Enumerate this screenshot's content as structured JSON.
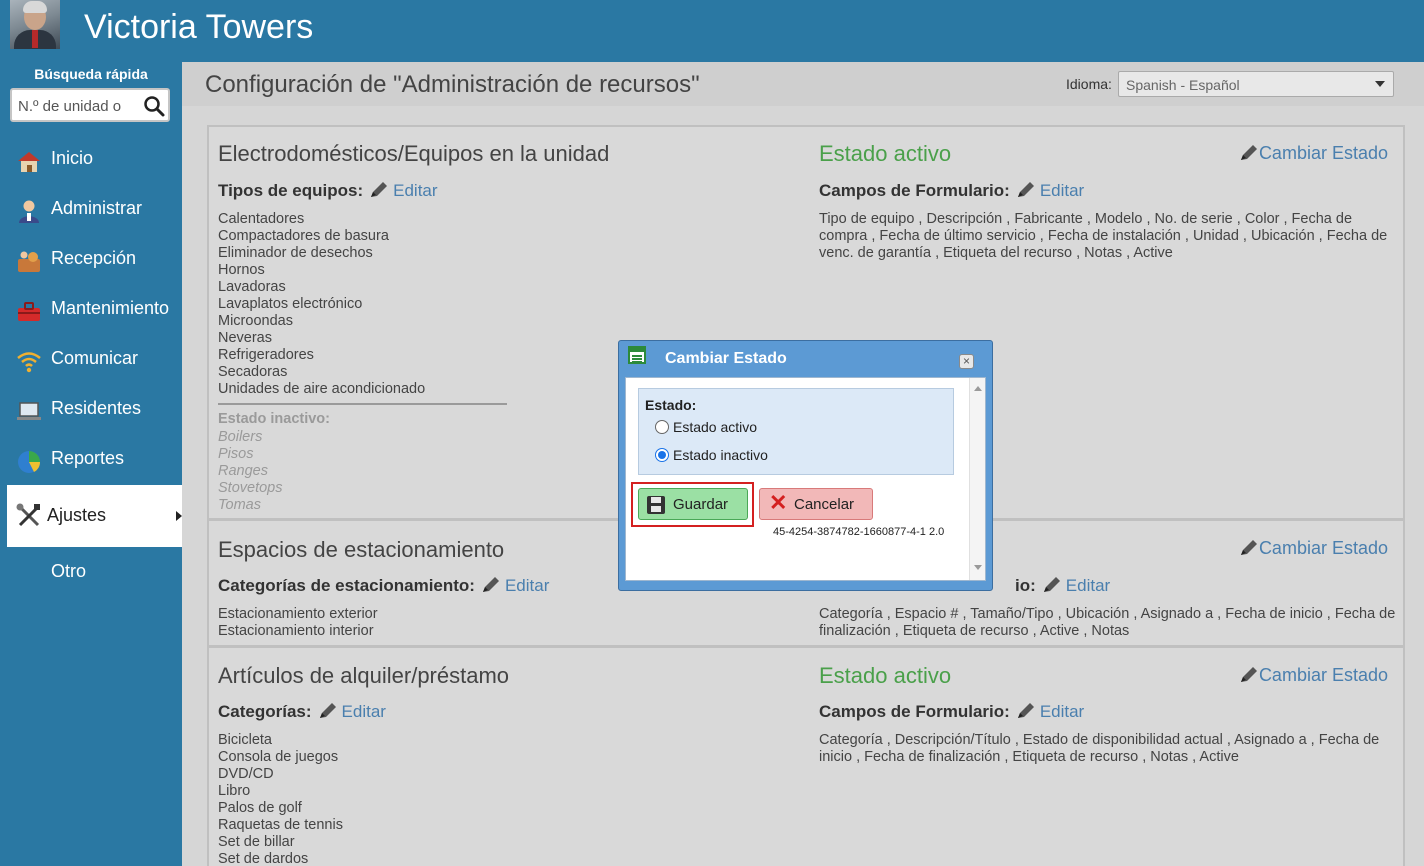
{
  "header": {
    "site_title": "Victoria Towers"
  },
  "sidebar": {
    "quick_search_label": "Búsqueda rápida",
    "quick_search_placeholder": "N.º de unidad o",
    "items": [
      {
        "label": "Inicio",
        "icon": "house-icon"
      },
      {
        "label": "Administrar",
        "icon": "user-admin-icon"
      },
      {
        "label": "Recepción",
        "icon": "reception-bell-icon"
      },
      {
        "label": "Mantenimiento",
        "icon": "toolbox-icon"
      },
      {
        "label": "Comunicar",
        "icon": "wifi-signal-icon"
      },
      {
        "label": "Residentes",
        "icon": "laptop-icon"
      },
      {
        "label": "Reportes",
        "icon": "pie-chart-icon"
      },
      {
        "label": "Ajustes",
        "icon": "tools-icon",
        "selected": true
      },
      {
        "label": "Otro"
      }
    ]
  },
  "page": {
    "title": "Configuración de \"Administración de recursos\"",
    "language_label": "Idioma:",
    "language_value": "Spanish - Español"
  },
  "sections": [
    {
      "title": "Electrodomésticos/Equipos en la unidad",
      "types_label": "Tipos de equipos:",
      "edit_label": "Editar",
      "items": [
        "Calentadores",
        "Compactadores de basura",
        "Eliminador de desechos",
        "Hornos",
        "Lavadoras",
        "Lavaplatos electrónico",
        "Microondas",
        "Neveras",
        "Refrigeradores",
        "Secadoras",
        "Unidades de aire acondicionado"
      ],
      "inactive_label": "Estado inactivo:",
      "inactive_items": [
        "Boilers",
        "Pisos",
        "Ranges",
        "Stovetops",
        "Tomas"
      ],
      "status": "Estado activo",
      "change_state": "Cambiar Estado",
      "form_fields_label": "Campos de Formulario:",
      "form_fields_edit": "Editar",
      "form_fields": "Tipo de equipo , Descripción , Fabricante , Modelo , No. de serie , Color , Fecha de compra , Fecha de último servicio , Fecha de instalación , Unidad , Ubicación , Fecha de venc. de garantía , Etiqueta del recurso , Notas , Active"
    },
    {
      "title": "Espacios de estacionamiento",
      "types_label": "Categorías de estacionamiento:",
      "edit_label": "Editar",
      "items": [
        "Estacionamiento exterior",
        "Estacionamiento interior"
      ],
      "change_state": "Cambiar Estado",
      "form_fields_label_visible": "io:",
      "form_fields_edit": "Editar",
      "form_fields": "Categoría , Espacio # , Tamaño/Tipo , Ubicación , Asignado a , Fecha de inicio , Fecha de finalización , Etiqueta de recurso , Active , Notas"
    },
    {
      "title": "Artículos de alquiler/préstamo",
      "types_label": "Categorías:",
      "edit_label": "Editar",
      "items": [
        "Bicicleta",
        "Consola de juegos",
        "DVD/CD",
        "Libro",
        "Palos de golf",
        "Raquetas de tennis",
        "Set de billar",
        "Set de dardos"
      ],
      "status": "Estado activo",
      "change_state": "Cambiar Estado",
      "form_fields_label": "Campos de Formulario:",
      "form_fields_edit": "Editar",
      "form_fields": "Categoría , Descripción/Título , Estado de disponibilidad actual , Asignado a , Fecha de inicio , Fecha de finalización , Etiqueta de recurso , Notas , Active"
    }
  ],
  "modal": {
    "title": "Cambiar Estado",
    "close_symbol": "×",
    "state_label": "Estado:",
    "options": [
      {
        "label": "Estado activo",
        "checked": false
      },
      {
        "label": "Estado inactivo",
        "checked": true
      }
    ],
    "save_label": "Guardar",
    "cancel_label": "Cancelar",
    "version_text": "45-4254-3874782-1660877-4-1 2.0"
  },
  "colors": {
    "header_blue": "#2a78a3",
    "active_green": "#4aa04a",
    "link_blue": "#4a7fae",
    "save_green": "#9be0a4",
    "cancel_red": "#f2b8b8",
    "highlight_red": "#d42020"
  }
}
